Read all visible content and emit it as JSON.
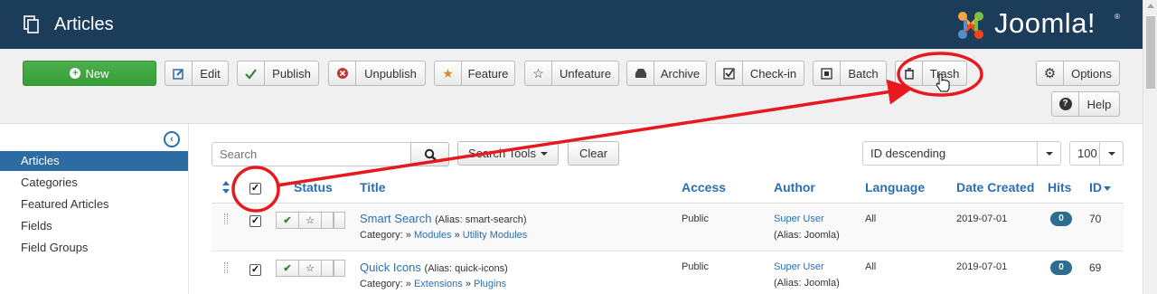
{
  "header": {
    "title": "Articles",
    "logo_text": "Joomla!",
    "logo_reg": "®"
  },
  "toolbar": {
    "new": "New",
    "edit": "Edit",
    "publish": "Publish",
    "unpublish": "Unpublish",
    "feature": "Feature",
    "unfeature": "Unfeature",
    "archive": "Archive",
    "checkin": "Check-in",
    "batch": "Batch",
    "trash": "Trash",
    "options": "Options",
    "help": "Help"
  },
  "sidebar": {
    "items": [
      {
        "label": "Articles"
      },
      {
        "label": "Categories"
      },
      {
        "label": "Featured Articles"
      },
      {
        "label": "Fields"
      },
      {
        "label": "Field Groups"
      }
    ]
  },
  "filters": {
    "search_placeholder": "Search",
    "search_tools": "Search Tools",
    "clear": "Clear",
    "ordering": "ID descending",
    "limit": "100"
  },
  "table": {
    "headers": {
      "status": "Status",
      "title": "Title",
      "access": "Access",
      "author": "Author",
      "language": "Language",
      "date_created": "Date Created",
      "hits": "Hits",
      "id": "ID"
    },
    "rows": [
      {
        "title": "Smart Search",
        "alias": "(Alias: smart-search)",
        "category_prefix": "Category: »",
        "category_parent": "Modules",
        "category_sep": "»",
        "category": "Utility Modules",
        "access": "Public",
        "author": "Super User",
        "author_alias": "(Alias: Joomla)",
        "language": "All",
        "date": "2019-07-01",
        "hits": "0",
        "id": "70"
      },
      {
        "title": "Quick Icons",
        "alias": "(Alias: quick-icons)",
        "category_prefix": "Category: »",
        "category_parent": "Extensions",
        "category_sep": "»",
        "category": "Plugins",
        "access": "Public",
        "author": "Super User",
        "author_alias": "(Alias: Joomla)",
        "language": "All",
        "date": "2019-07-01",
        "hits": "0",
        "id": "69"
      }
    ]
  },
  "colors": {
    "header_bg": "#1c3d5a",
    "new_button": "#43a944",
    "active_sidebar": "#2d6ca2",
    "link": "#2a6fb2",
    "annotation": "#e8191e"
  },
  "icons": {
    "header": "pages-icon",
    "search": "search-icon",
    "collapse": "collapse-sidebar-icon"
  }
}
